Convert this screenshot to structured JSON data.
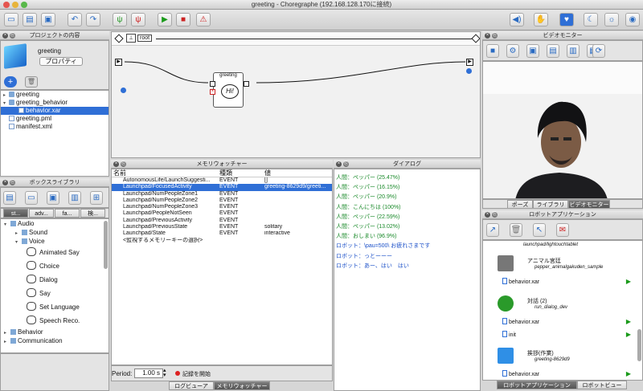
{
  "window": {
    "title": "greeting - Choregraphe (192.168.128.170に接続)"
  },
  "project_panel": {
    "header": "プロジェクトの内容",
    "project_name": "greeting",
    "properties_button": "プロパティ",
    "tree": [
      {
        "label": "greeting",
        "type": "folder",
        "indent": 0,
        "selected": false
      },
      {
        "label": "greeting_behavior",
        "type": "folder",
        "indent": 0,
        "selected": false
      },
      {
        "label": "behavior.xar",
        "type": "file",
        "indent": 1,
        "selected": true
      },
      {
        "label": "greeting.pml",
        "type": "file",
        "indent": 0,
        "selected": false
      },
      {
        "label": "manifest.xml",
        "type": "file",
        "indent": 0,
        "selected": false
      }
    ]
  },
  "box_library": {
    "header": "ボックスライブラリ",
    "tabs": [
      "st...",
      "adv...",
      "fa...",
      "検..."
    ],
    "tree": [
      {
        "label": "Audio",
        "indent": 0,
        "kind": "folder"
      },
      {
        "label": "Sound",
        "indent": 1,
        "kind": "folder"
      },
      {
        "label": "Voice",
        "indent": 1,
        "kind": "folder"
      },
      {
        "label": "Animated Say",
        "indent": 2,
        "kind": "box"
      },
      {
        "label": "Choice",
        "indent": 2,
        "kind": "box"
      },
      {
        "label": "Dialog",
        "indent": 2,
        "kind": "box"
      },
      {
        "label": "Say",
        "indent": 2,
        "kind": "box"
      },
      {
        "label": "Set Language",
        "indent": 2,
        "kind": "box"
      },
      {
        "label": "Speech Reco.",
        "indent": 2,
        "kind": "box"
      },
      {
        "label": "Behavior",
        "indent": 0,
        "kind": "folder"
      },
      {
        "label": "Communication",
        "indent": 0,
        "kind": "folder"
      }
    ]
  },
  "flow": {
    "breadcrumb": "root",
    "box_label": "greeting",
    "bubble_text": "Hi!"
  },
  "memory_watcher": {
    "header": "メモリウォッチャー",
    "columns": [
      "名前",
      "種類",
      "値"
    ],
    "rows": [
      {
        "name": "AutonomousLife/LaunchSuggesti...",
        "type": "EVENT",
        "value": "[]",
        "selected": false
      },
      {
        "name": "Launchpad/FocusedActivity",
        "type": "EVENT",
        "value": "greeting-8629d9/greeti...",
        "selected": true
      },
      {
        "name": "Launchpad/NumPeopleZone1",
        "type": "EVENT",
        "value": "",
        "selected": false
      },
      {
        "name": "Launchpad/NumPeopleZone2",
        "type": "EVENT",
        "value": "",
        "selected": false
      },
      {
        "name": "Launchpad/NumPeopleZone3",
        "type": "EVENT",
        "value": "",
        "selected": false
      },
      {
        "name": "Launchpad/PeopleNotSeen",
        "type": "EVENT",
        "value": "",
        "selected": false
      },
      {
        "name": "Launchpad/PreviousActivity",
        "type": "EVENT",
        "value": "",
        "selected": false
      },
      {
        "name": "Launchpad/PreviousState",
        "type": "EVENT",
        "value": "solitary",
        "selected": false
      },
      {
        "name": "Launchpad/State",
        "type": "EVENT",
        "value": "interactive",
        "selected": false
      },
      {
        "name": "<監視するメモリーキーの選択>",
        "type": "",
        "value": "",
        "selected": false
      }
    ],
    "period_label": "Period:",
    "period_value": "1.00 s",
    "record_label": "記録を開始",
    "bottom_tabs": [
      "ログビューア",
      "メモリウォッチャー"
    ]
  },
  "dialog": {
    "header": "ダイアログ",
    "lines": [
      {
        "text": "人間：ペッパー (25.47%)",
        "color": "#1a8a2a"
      },
      {
        "text": "人間：ペッパー (16.15%)",
        "color": "#1a8a2a"
      },
      {
        "text": "人間：ペッパー (20.9%)",
        "color": "#1a8a2a"
      },
      {
        "text": "人間：こんにちは (100%)",
        "color": "#1a8a2a"
      },
      {
        "text": "人間：ペッパー (22.59%)",
        "color": "#1a8a2a"
      },
      {
        "text": "人間：ペッパー (13.02%)",
        "color": "#1a8a2a"
      },
      {
        "text": "人間：おしまい (96.9%)",
        "color": "#1a8a2a"
      },
      {
        "text": "ロボット：\\pau=500\\ お疲れさまです",
        "color": "#1a4fc8"
      },
      {
        "text": "ロボット：っとーーー",
        "color": "#1a4fc8"
      },
      {
        "text": "ロボット：あー、はい　はい",
        "color": "#1a4fc8"
      }
    ]
  },
  "video_monitor": {
    "header": "ビデオモニター",
    "tabs": [
      "ポーズ",
      "ライブラリ",
      "ビデオモニター"
    ]
  },
  "robot_apps": {
    "header": "ロボットアプリケーション",
    "top_path": "launchpad/lightouchtablet",
    "apps": [
      {
        "name": "アニマル宮廷",
        "sub": "pepper_animalgakuden_sample",
        "behavior": "behavior.xar"
      },
      {
        "name": "対話 (2)",
        "sub": "run_dialog_dev",
        "behavior": "behavior.xar",
        "extra": "init"
      },
      {
        "name": "挨拶(作業)",
        "sub": "greeting-8629d9",
        "behavior": "behavior.xar"
      }
    ],
    "bottom_tabs": [
      "ロボットアプリケーション",
      "ロボットビュー"
    ]
  }
}
